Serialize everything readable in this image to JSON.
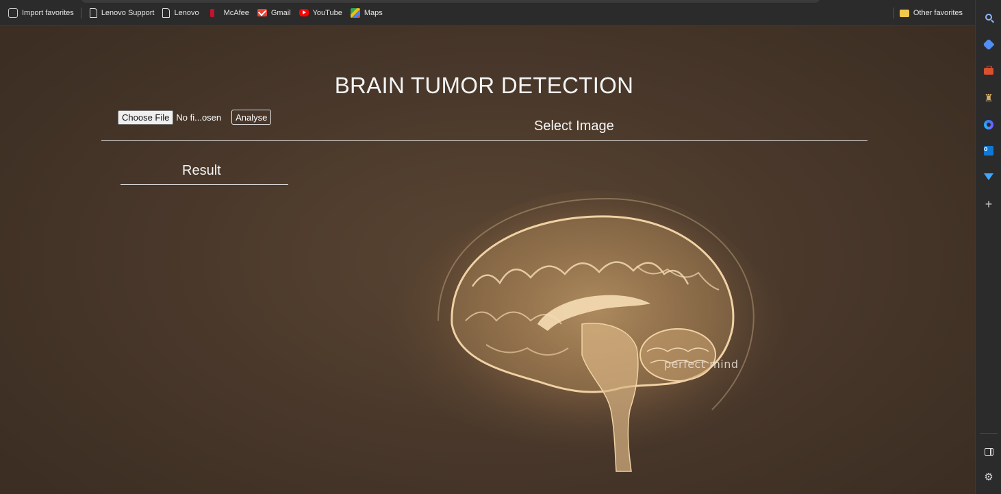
{
  "favorites_bar": {
    "items": [
      {
        "label": "Import favorites",
        "icon": "import-icon"
      },
      {
        "label": "Lenovo Support",
        "icon": "page-icon"
      },
      {
        "label": "Lenovo",
        "icon": "page-icon"
      },
      {
        "label": "McAfee",
        "icon": "mcafee-icon"
      },
      {
        "label": "Gmail",
        "icon": "gmail-icon"
      },
      {
        "label": "YouTube",
        "icon": "youtube-icon"
      },
      {
        "label": "Maps",
        "icon": "maps-icon"
      }
    ],
    "other_favorites": {
      "label": "Other favorites",
      "icon": "folder-icon"
    }
  },
  "sidebar": {
    "icons": [
      "search-icon",
      "tag-icon",
      "briefcase-icon",
      "chess-icon",
      "copilot-icon",
      "outlook-icon",
      "send-icon",
      "plus-icon",
      "panel-icon",
      "settings-icon"
    ]
  },
  "page": {
    "title": "BRAIN TUMOR DETECTION",
    "choose_file_label": "Choose File",
    "no_file_text": "No fi...osen",
    "analyse_label": "Analyse",
    "select_image_label": "Select Image",
    "result_label": "Result",
    "background_caption": "perfect mind"
  },
  "colors": {
    "background": "#4a392b",
    "text": "#f4f4f4",
    "brain_highlight": "#e9c79a"
  }
}
